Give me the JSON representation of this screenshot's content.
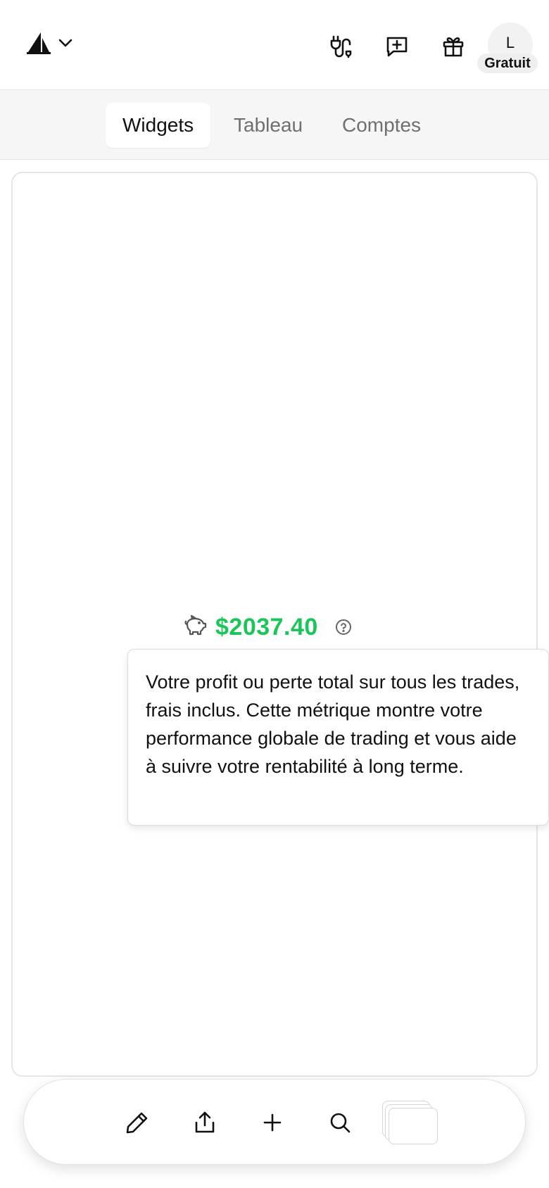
{
  "header": {
    "logo_icon": "sail-logo-icon",
    "menu_icon": "chevron-down-icon",
    "icons": [
      "plug-icon",
      "message-plus-icon",
      "gift-icon"
    ],
    "avatar_letter": "L",
    "plan_badge": "Gratuit"
  },
  "tabs": [
    {
      "label": "Widgets",
      "active": true
    },
    {
      "label": "Tableau",
      "active": false
    },
    {
      "label": "Comptes",
      "active": false
    }
  ],
  "widget": {
    "icon": "piggy-bank-icon",
    "value": "$2037.40",
    "value_color": "#1cc55a",
    "help_icon": "question-circle-icon",
    "tooltip": "Votre profit ou perte total sur tous les trades, frais inclus. Cette métrique montre votre performance globale de trading et vous aide à suivre votre rentabilité à long terme."
  },
  "toolbar": {
    "icons": [
      "pencil-icon",
      "share-icon",
      "plus-icon",
      "search-icon",
      "layers-stack-icon"
    ]
  }
}
